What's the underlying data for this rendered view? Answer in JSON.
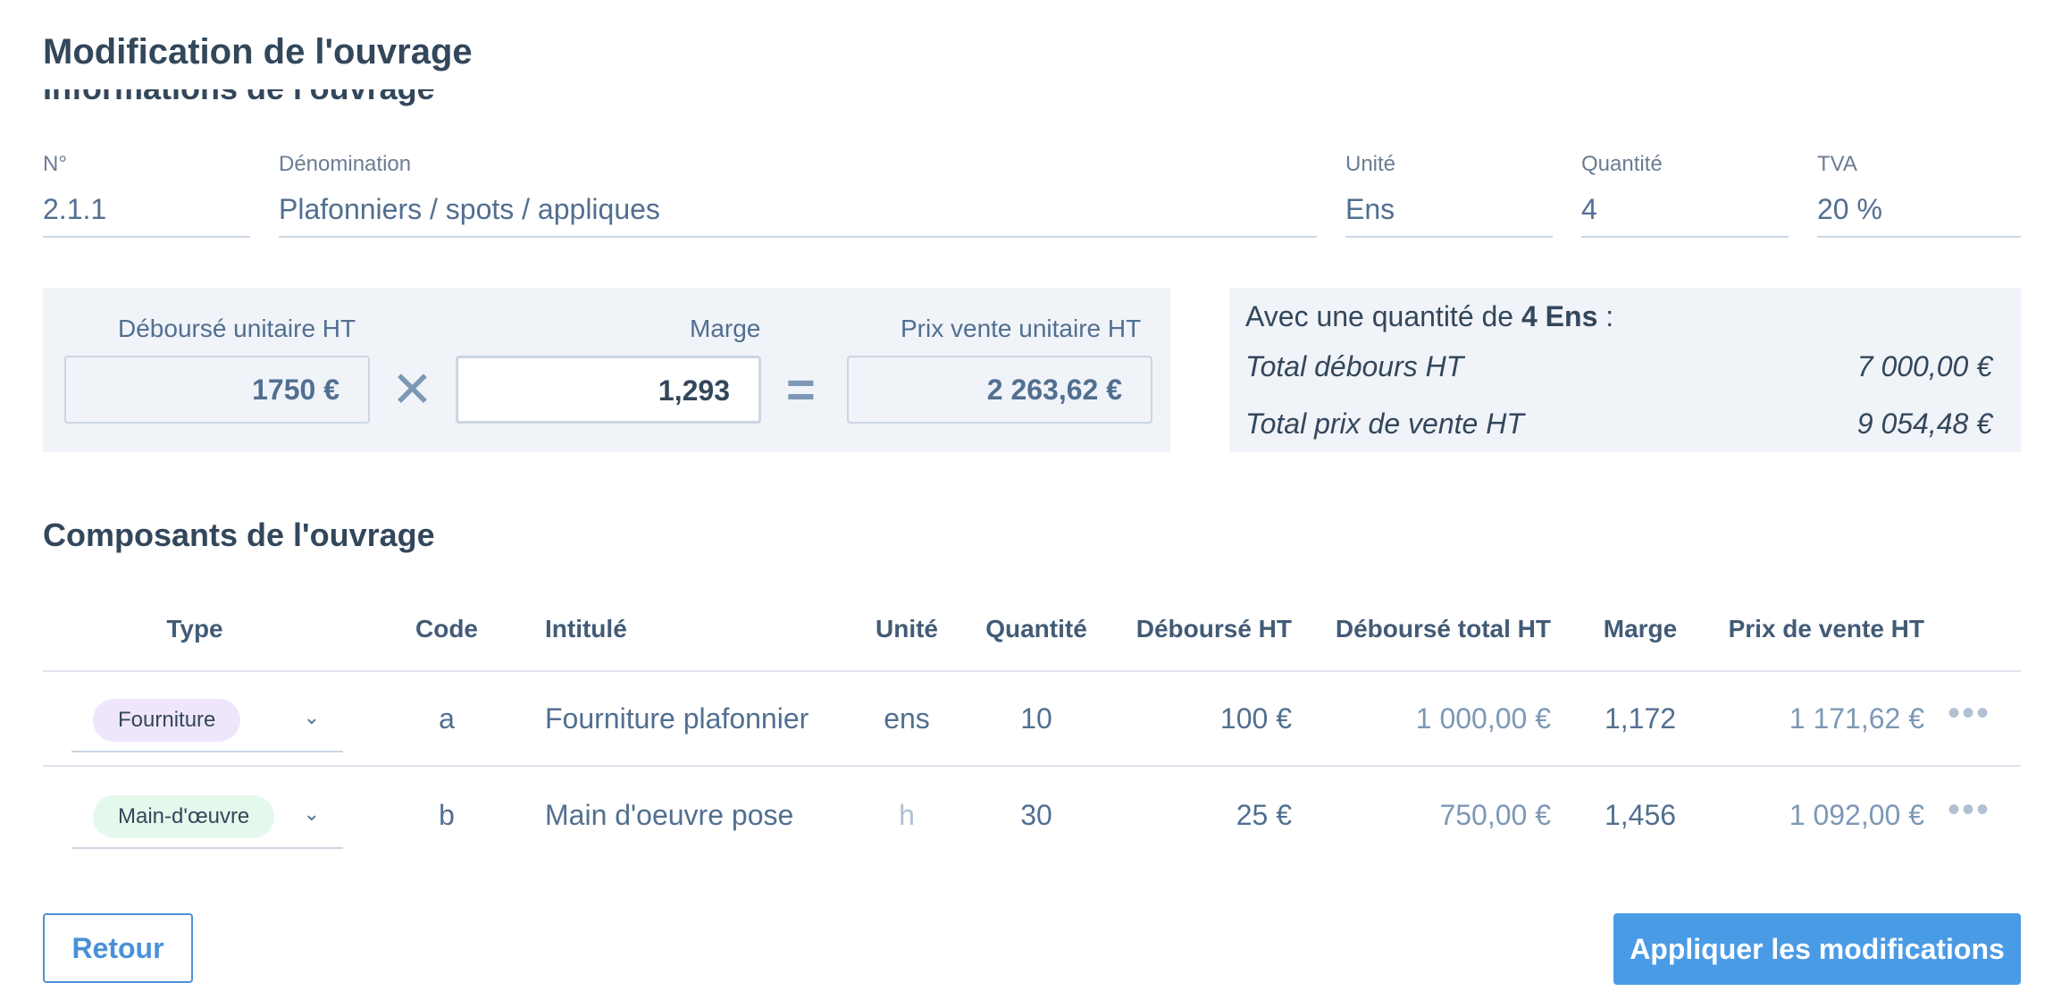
{
  "modal": {
    "title": "Modification de l'ouvrage",
    "section_cut_title": "Informations de l'ouvrage"
  },
  "info": {
    "num_label": "N°",
    "num_value": "2.1.1",
    "denom_label": "Dénomination",
    "denom_value": "Plafonniers / spots / appliques",
    "unit_label": "Unité",
    "unit_value": "Ens",
    "qty_label": "Quantité",
    "qty_value": "4",
    "tva_label": "TVA",
    "tva_value": "20 %"
  },
  "calc": {
    "debourse_label": "Déboursé unitaire HT",
    "debourse_value": "1750 €",
    "op_multiply": "✕",
    "marge_label": "Marge",
    "marge_value": "1,293",
    "op_equals": "=",
    "prix_label": "Prix vente unitaire HT",
    "prix_value": "2 263,62 €"
  },
  "summary": {
    "intro_prefix": "Avec une quantité de",
    "intro_qty": "4 Ens",
    "intro_suffix": ":",
    "total_debours_label": "Total débours HT",
    "total_debours_value": "7 000,00 €",
    "total_prix_label": "Total prix de vente HT",
    "total_prix_value": "9 054,48 €"
  },
  "components": {
    "title": "Composants de l'ouvrage",
    "headers": {
      "type": "Type",
      "code": "Code",
      "intitule": "Intitulé",
      "unite": "Unité",
      "quantite": "Quantité",
      "debourse": "Déboursé HT",
      "debourse_total": "Déboursé total HT",
      "marge": "Marge",
      "prix": "Prix de vente HT"
    },
    "rows": [
      {
        "type": "Fourniture",
        "code": "a",
        "intitule": "Fourniture plafonnier",
        "unite": "ens",
        "quantite": "10",
        "debourse": "100 €",
        "debourse_total": "1 000,00 €",
        "marge": "1,172",
        "prix": "1 171,62 €"
      },
      {
        "type": "Main-d'œuvre",
        "code": "b",
        "intitule": "Main d'oeuvre pose",
        "unite": "h",
        "quantite": "30",
        "debourse": "25 €",
        "debourse_total": "750,00 €",
        "marge": "1,456",
        "prix": "1 092,00 €"
      }
    ]
  },
  "footer": {
    "back_label": "Retour",
    "apply_label": "Appliquer les modifications"
  },
  "icons": {
    "chevron": "chevron-down-icon",
    "more": "more-horizontal-icon"
  },
  "colors": {
    "accent": "#4a9be6",
    "text": "#33475b",
    "panel": "#f0f3f8"
  }
}
